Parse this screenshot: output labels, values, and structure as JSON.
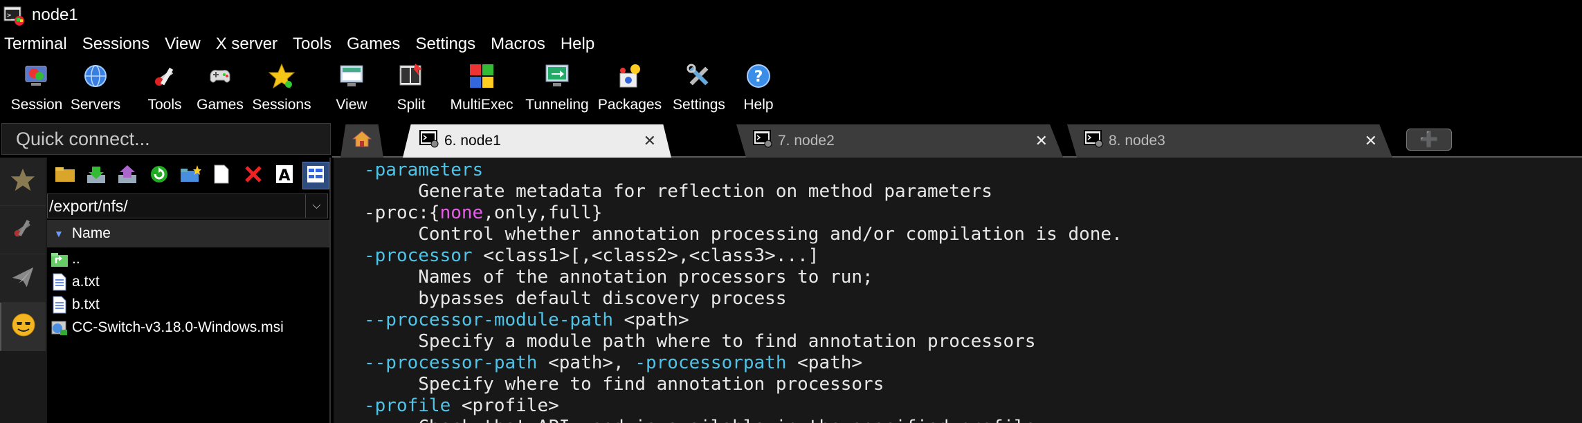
{
  "window": {
    "title": "node1"
  },
  "menu": [
    "Terminal",
    "Sessions",
    "View",
    "X server",
    "Tools",
    "Games",
    "Settings",
    "Macros",
    "Help"
  ],
  "toolbar": [
    {
      "label": "Session",
      "icon": "session-icon"
    },
    {
      "label": "Servers",
      "icon": "servers-icon"
    },
    {
      "label": "Tools",
      "icon": "tools-icon"
    },
    {
      "label": "Games",
      "icon": "games-icon"
    },
    {
      "label": "Sessions",
      "icon": "sessions-star-icon"
    },
    {
      "label": "View",
      "icon": "view-icon"
    },
    {
      "label": "Split",
      "icon": "split-icon"
    },
    {
      "label": "MultiExec",
      "icon": "multiexec-icon"
    },
    {
      "label": "Tunneling",
      "icon": "tunneling-icon"
    },
    {
      "label": "Packages",
      "icon": "packages-icon"
    },
    {
      "label": "Settings",
      "icon": "settings-icon"
    },
    {
      "label": "Help",
      "icon": "help-icon"
    }
  ],
  "quick_connect": {
    "placeholder": "Quick connect..."
  },
  "sftp": {
    "path": "/export/nfs/",
    "column_name": "Name",
    "files": [
      {
        "name": "..",
        "icon": "parent-folder-icon"
      },
      {
        "name": "a.txt",
        "icon": "text-file-icon"
      },
      {
        "name": "b.txt",
        "icon": "text-file-icon"
      },
      {
        "name": "CC-Switch-v3.18.0-Windows.msi",
        "icon": "msi-installer-icon"
      }
    ]
  },
  "tabs": [
    {
      "label": "6. node1",
      "active": true
    },
    {
      "label": "7. node2",
      "active": false
    },
    {
      "label": "8. node3",
      "active": false
    }
  ],
  "terminal": {
    "lines": [
      [
        {
          "t": "-parameters",
          "c": "cyan"
        }
      ],
      [
        {
          "t": "     Generate metadata for reflection on method parameters",
          "c": "white"
        }
      ],
      [
        {
          "t": "-proc:{",
          "c": "white"
        },
        {
          "t": "none",
          "c": "mag"
        },
        {
          "t": ",only,full}",
          "c": "white"
        }
      ],
      [
        {
          "t": "     Control whether annotation processing and/or compilation is done.",
          "c": "white"
        }
      ],
      [
        {
          "t": "-processor",
          "c": "cyan"
        },
        {
          "t": " <class1>[,<class2>,<class3>...]",
          "c": "white"
        }
      ],
      [
        {
          "t": "     Names of the annotation processors to run;",
          "c": "white"
        }
      ],
      [
        {
          "t": "     bypasses default discovery process",
          "c": "white"
        }
      ],
      [
        {
          "t": "--processor-module-path",
          "c": "cyan"
        },
        {
          "t": " <path>",
          "c": "white"
        }
      ],
      [
        {
          "t": "     Specify a module path where to find annotation processors",
          "c": "white"
        }
      ],
      [
        {
          "t": "--processor-path",
          "c": "cyan"
        },
        {
          "t": " <path>, ",
          "c": "white"
        },
        {
          "t": "-processorpath",
          "c": "cyan"
        },
        {
          "t": " <path>",
          "c": "white"
        }
      ],
      [
        {
          "t": "     Specify where to find annotation processors",
          "c": "white"
        }
      ],
      [
        {
          "t": "-profile",
          "c": "cyan"
        },
        {
          "t": " <profile>",
          "c": "white"
        }
      ],
      [
        {
          "t": "     Check that API used is available in the specified profile",
          "c": "white"
        }
      ]
    ]
  }
}
